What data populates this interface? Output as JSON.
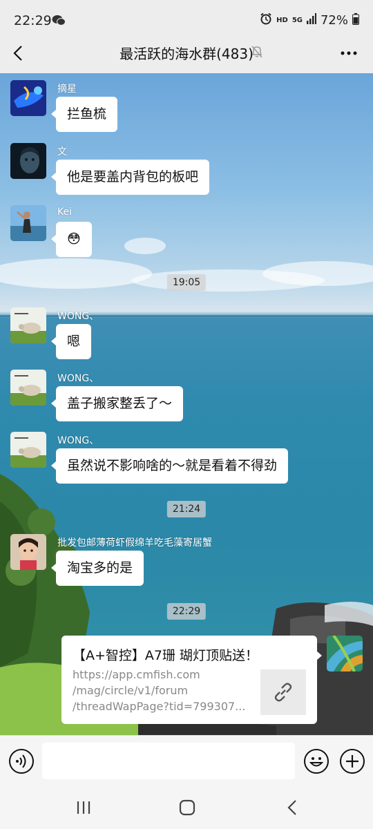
{
  "status_bar": {
    "time": "22:29",
    "network": "HD",
    "signal": "5G",
    "battery": "72%"
  },
  "header": {
    "title": "最活跃的海水群(483)"
  },
  "messages": [
    {
      "sender": "摘星",
      "text": "拦鱼梳"
    },
    {
      "sender": "文",
      "text": "他是要盖内背包的板吧"
    },
    {
      "sender": "Kei",
      "text": "😳"
    },
    {
      "sender": "WONG、",
      "text": "嗯"
    },
    {
      "sender": "WONG、",
      "text": "盖子搬家整丢了～"
    },
    {
      "sender": "WONG、",
      "text": "虽然说不影响啥的～就是看着不得劲"
    },
    {
      "sender": "批发包邮薄荷虾假绵羊吃毛藻寄居蟹",
      "text": "淘宝多的是"
    }
  ],
  "timestamps": [
    "19:05",
    "21:24",
    "22:29"
  ],
  "link_card": {
    "title": "【A+智控】A7珊 瑚灯顶贴送！",
    "url_lines": [
      "https://app.cmfish.com",
      "/mag/circle/v1/forum",
      "/threadWapPage?tid=799307..."
    ]
  },
  "input": {
    "placeholder": ""
  },
  "colors": {
    "bubble": "#ffffff",
    "background": "#ededed",
    "timestamp_bg": "#d2d2d2"
  }
}
